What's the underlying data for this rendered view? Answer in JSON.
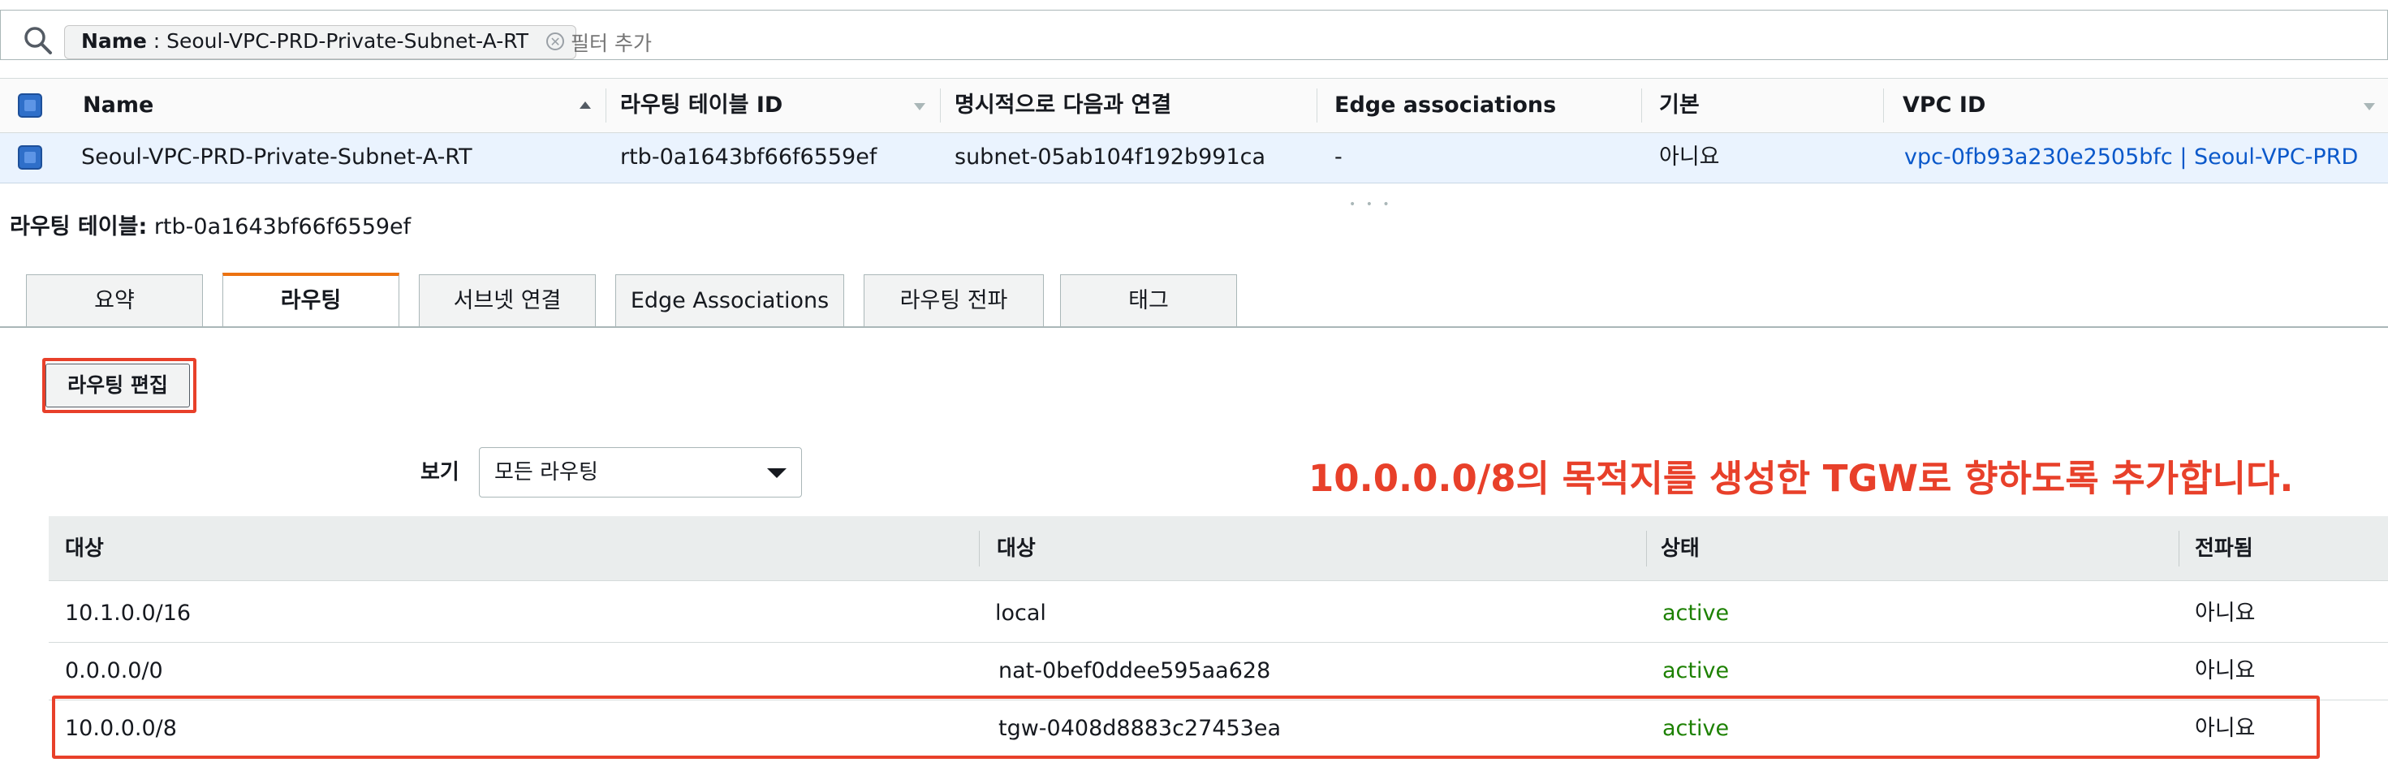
{
  "filter": {
    "chip_key": "Name",
    "chip_value": " : Seoul-VPC-PRD-Private-Subnet-A-RT",
    "placeholder": "필터 추가"
  },
  "top_table": {
    "columns": [
      "Name",
      "라우팅 테이블 ID",
      "명시적으로 다음과 연결",
      "Edge associations",
      "기본",
      "VPC ID"
    ],
    "row": {
      "name": "Seoul-VPC-PRD-Private-Subnet-A-RT",
      "route_table_id": "rtb-0a1643bf66f6559ef",
      "explicit_association": "subnet-05ab104f192b991ca",
      "edge_associations": "-",
      "main": "아니요",
      "vpc_id": "vpc-0fb93a230e2505bfc | Seoul-VPC-PRD"
    }
  },
  "detail": {
    "label": "라우팅 테이블:",
    "value": " rtb-0a1643bf66f6559ef"
  },
  "tabs": [
    {
      "label": "요약"
    },
    {
      "label": "라우팅"
    },
    {
      "label": "서브넷 연결"
    },
    {
      "label": "Edge Associations"
    },
    {
      "label": "라우팅 전파"
    },
    {
      "label": "태그"
    }
  ],
  "active_tab": "라우팅",
  "edit_button": "라우팅 편집",
  "view": {
    "label": "보기",
    "selected": "모든 라우팅"
  },
  "annotation": "10.0.0.0/8의 목적지를 생성한 TGW로 향하도록 추가합니다.",
  "routes": {
    "columns": [
      "대상",
      "대상",
      "상태",
      "전파됨"
    ],
    "rows": [
      {
        "destination": "10.1.0.0/16",
        "target": "local",
        "status": "active",
        "propagated": "아니요"
      },
      {
        "destination": "0.0.0.0/0",
        "target": "nat-0bef0ddee595aa628",
        "status": "active",
        "propagated": "아니요"
      },
      {
        "destination": "10.0.0.0/8",
        "target": "tgw-0408d8883c27453ea",
        "status": "active",
        "propagated": "아니요"
      }
    ]
  },
  "colors": {
    "accent": "#ec7211",
    "link": "#0a58ca",
    "status_active": "#1d8102",
    "highlight": "#e8402a",
    "selected_row": "#eaf3fe"
  }
}
